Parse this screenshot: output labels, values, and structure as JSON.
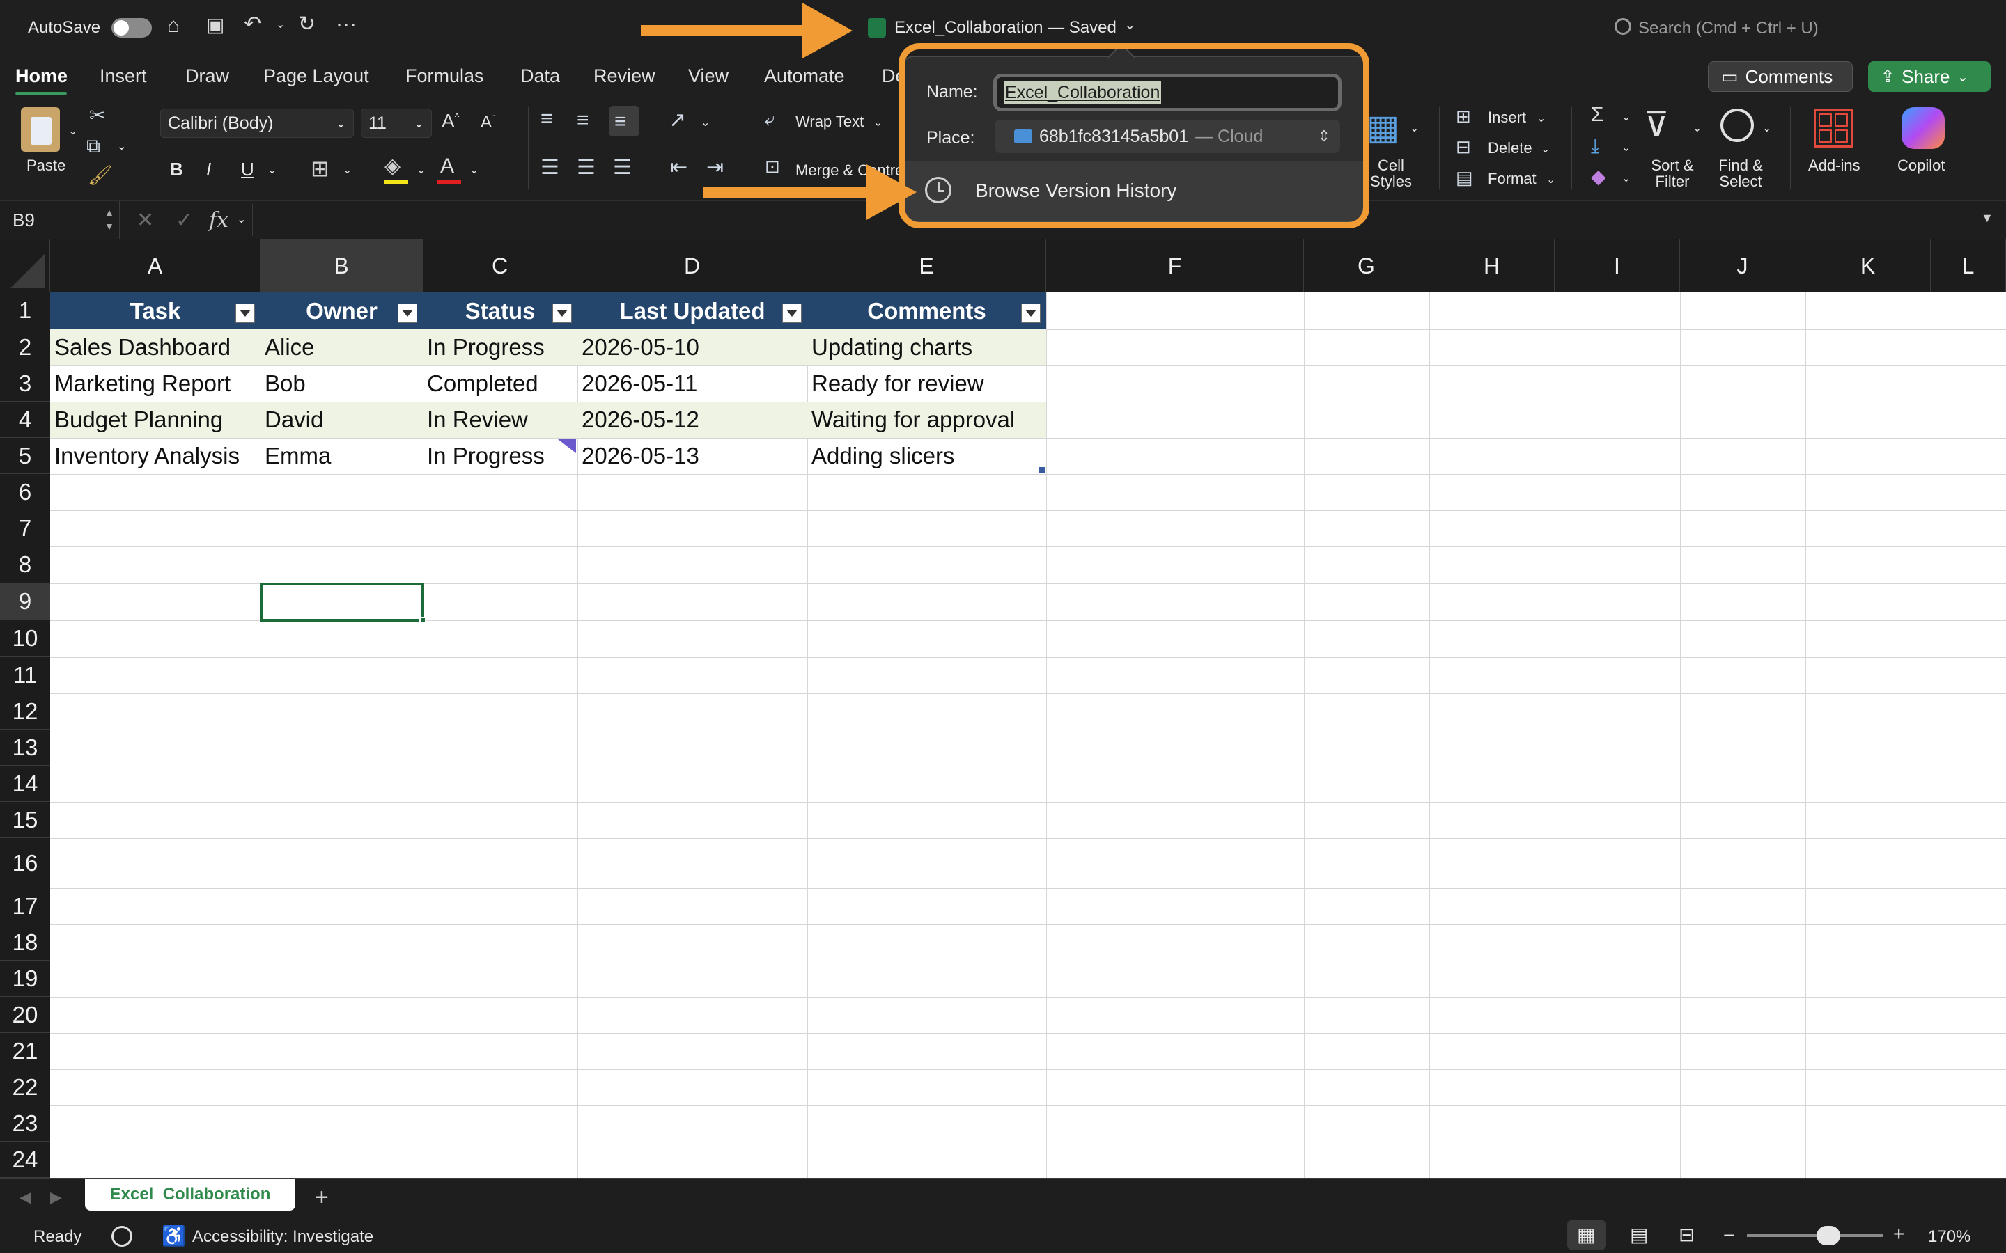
{
  "titlebar": {
    "autosave_label": "AutoSave",
    "doc_title": "Excel_Collaboration — Saved",
    "search_placeholder": "Search (Cmd + Ctrl + U)"
  },
  "tabs": {
    "items": [
      "Home",
      "Insert",
      "Draw",
      "Page Layout",
      "Formulas",
      "Data",
      "Review",
      "View",
      "Automate",
      "De"
    ],
    "active": "Home",
    "comments_label": "Comments",
    "share_label": "Share"
  },
  "ribbon": {
    "paste_label": "Paste",
    "font_name": "Calibri (Body)",
    "font_size": "11",
    "wrap_text": "Wrap Text",
    "merge_label": "Merge & Centre",
    "cell_styles": "Cell Styles",
    "insert": "Insert",
    "delete": "Delete",
    "format": "Format",
    "sort_filter": "Sort & Filter",
    "find_select": "Find & Select",
    "addins": "Add-ins",
    "copilot": "Copilot",
    "bold": "B",
    "italic": "I",
    "underline": "U"
  },
  "formula_bar": {
    "name_box": "B9",
    "fx": "fx",
    "value": ""
  },
  "grid": {
    "columns": [
      "A",
      "B",
      "C",
      "D",
      "E",
      "F",
      "G",
      "H",
      "I",
      "J",
      "K",
      "L"
    ],
    "rows": [
      "1",
      "2",
      "3",
      "4",
      "5",
      "6",
      "7",
      "8",
      "9",
      "10",
      "11",
      "12",
      "13",
      "14",
      "15",
      "16",
      "17",
      "18",
      "19",
      "20",
      "21",
      "22",
      "23",
      "24"
    ],
    "selected_cell": "B9",
    "table_headers": [
      "Task",
      "Owner",
      "Status",
      "Last Updated",
      "Comments"
    ],
    "table_rows": [
      [
        "Sales Dashboard",
        "Alice",
        "In Progress",
        "2026-05-10",
        "Updating charts"
      ],
      [
        "Marketing Report",
        "Bob",
        "Completed",
        "2026-05-11",
        "Ready for review"
      ],
      [
        "Budget Planning",
        "David",
        "In Review",
        "2026-05-12",
        "Waiting for approval"
      ],
      [
        "Inventory Analysis",
        "Emma",
        "In Progress",
        "2026-05-13",
        "Adding slicers"
      ]
    ],
    "band_color": "#eef3e4",
    "header_color": "#24466d"
  },
  "popup": {
    "name_label": "Name:",
    "name_value": "Excel_Collaboration",
    "place_label": "Place:",
    "place_value": "68b1fc83145a5b01",
    "place_suffix": "— Cloud",
    "version_history": "Browse Version History"
  },
  "sheets": {
    "tabs": [
      "Excel_Collaboration"
    ],
    "add_label": "+"
  },
  "status": {
    "ready": "Ready",
    "accessibility": "Accessibility: Investigate",
    "zoom": "170%",
    "zoom_minus": "−",
    "zoom_plus": "+"
  },
  "colors": {
    "accent_green": "#3a9b5f",
    "annotation_orange": "#f09b34"
  }
}
